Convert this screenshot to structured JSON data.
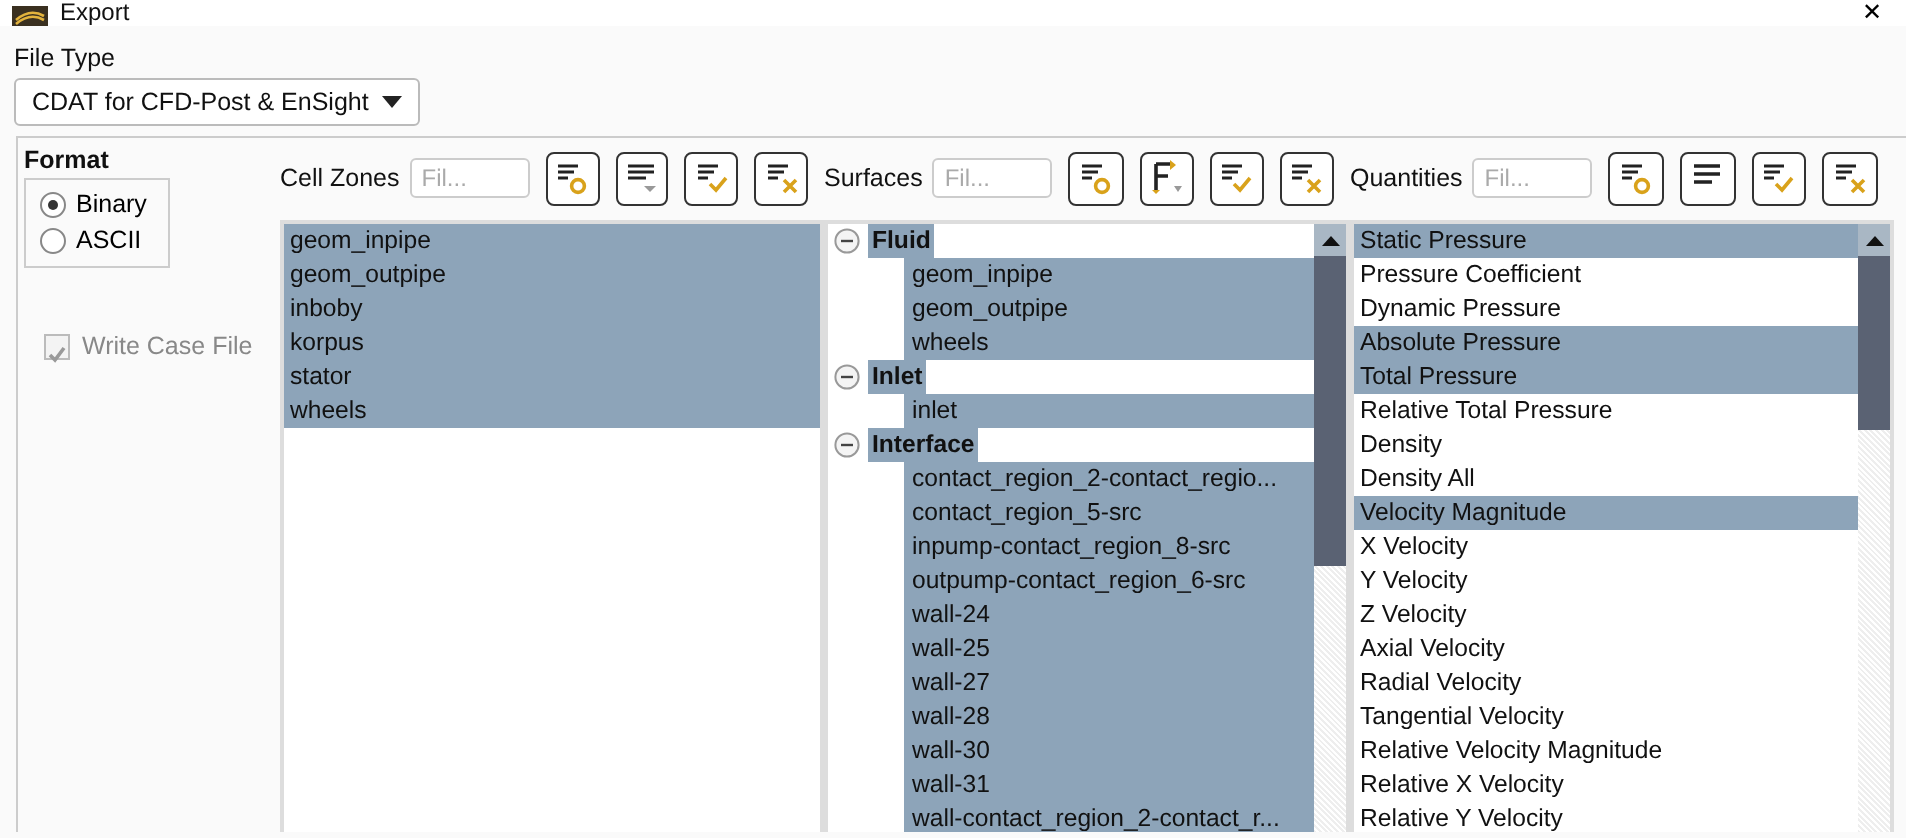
{
  "window": {
    "title": "Export",
    "close": "✕"
  },
  "file_type": {
    "label": "File Type",
    "value": "CDAT for CFD-Post & EnSight"
  },
  "format": {
    "label": "Format",
    "options": [
      {
        "label": "Binary",
        "selected": true
      },
      {
        "label": "ASCII",
        "selected": false
      }
    ]
  },
  "write_case_file": {
    "label": "Write Case File",
    "checked": true,
    "disabled": true
  },
  "panels": [
    {
      "kind": "list",
      "label": "Cell Zones",
      "placeholder": "Fil...",
      "tools": [
        {
          "kind": "highlight"
        },
        {
          "kind": "sort"
        },
        {
          "kind": "all"
        },
        {
          "kind": "none"
        }
      ],
      "items": [
        {
          "label": "geom_inpipe",
          "selected": true
        },
        {
          "label": "geom_outpipe",
          "selected": true
        },
        {
          "label": "inboby",
          "selected": true
        },
        {
          "label": "korpus",
          "selected": true
        },
        {
          "label": "stator",
          "selected": true
        },
        {
          "label": "wheels",
          "selected": true
        }
      ]
    },
    {
      "kind": "tree",
      "label": "Surfaces",
      "placeholder": "Fil...",
      "tools": [
        {
          "kind": "highlight"
        },
        {
          "kind": "group"
        },
        {
          "kind": "all"
        },
        {
          "kind": "none"
        }
      ],
      "items": [
        {
          "label": "Fluid",
          "selected": true,
          "expanded": true,
          "children": [
            {
              "label": "geom_inpipe",
              "selected": true
            },
            {
              "label": "geom_outpipe",
              "selected": true
            },
            {
              "label": "wheels",
              "selected": true
            }
          ]
        },
        {
          "label": "Inlet",
          "selected": true,
          "expanded": true,
          "children": [
            {
              "label": "inlet",
              "selected": true
            }
          ]
        },
        {
          "label": "Interface",
          "selected": true,
          "expanded": true,
          "children": [
            {
              "label": "contact_region_2-contact_regio...",
              "selected": true
            },
            {
              "label": "contact_region_5-src",
              "selected": true
            },
            {
              "label": "inpump-contact_region_8-src",
              "selected": true
            },
            {
              "label": "outpump-contact_region_6-src",
              "selected": true
            },
            {
              "label": "wall-24",
              "selected": true
            },
            {
              "label": "wall-25",
              "selected": true
            },
            {
              "label": "wall-27",
              "selected": true
            },
            {
              "label": "wall-28",
              "selected": true
            },
            {
              "label": "wall-30",
              "selected": true
            },
            {
              "label": "wall-31",
              "selected": true
            },
            {
              "label": "wall-contact_region_2-contact_r...",
              "selected": true
            }
          ]
        }
      ]
    },
    {
      "kind": "list",
      "label": "Quantities",
      "placeholder": "Fil...",
      "tools": [
        {
          "kind": "highlight"
        },
        {
          "kind": "lines"
        },
        {
          "kind": "all"
        },
        {
          "kind": "none"
        }
      ],
      "items": [
        {
          "label": "Static Pressure",
          "selected": true
        },
        {
          "label": "Pressure Coefficient",
          "selected": false
        },
        {
          "label": "Dynamic Pressure",
          "selected": false
        },
        {
          "label": "Absolute Pressure",
          "selected": true
        },
        {
          "label": "Total Pressure",
          "selected": true
        },
        {
          "label": "Relative Total Pressure",
          "selected": false
        },
        {
          "label": "Density",
          "selected": false
        },
        {
          "label": "Density All",
          "selected": false
        },
        {
          "label": "Velocity Magnitude",
          "selected": true
        },
        {
          "label": "X Velocity",
          "selected": false
        },
        {
          "label": "Y Velocity",
          "selected": false
        },
        {
          "label": "Z Velocity",
          "selected": false
        },
        {
          "label": "Axial Velocity",
          "selected": false
        },
        {
          "label": "Radial Velocity",
          "selected": false
        },
        {
          "label": "Tangential Velocity",
          "selected": false
        },
        {
          "label": "Relative Velocity Magnitude",
          "selected": false
        },
        {
          "label": "Relative X Velocity",
          "selected": false
        },
        {
          "label": "Relative Y Velocity",
          "selected": false
        }
      ]
    }
  ]
}
